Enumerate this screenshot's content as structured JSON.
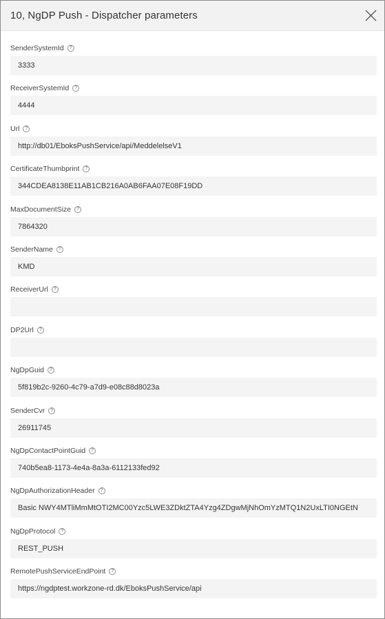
{
  "dialog": {
    "title": "10, NgDP Push - Dispatcher parameters",
    "close_icon": "close-icon"
  },
  "fields": [
    {
      "label": "SenderSystemId",
      "value": "3333"
    },
    {
      "label": "ReceiverSystemId",
      "value": "4444"
    },
    {
      "label": "Url",
      "value": "http://db01/EboksPushService/api/MeddelelseV1"
    },
    {
      "label": "CertificateThumbprint",
      "value": "344CDEA8138E11AB1CB216A0AB6FAA07E08F19DD"
    },
    {
      "label": "MaxDocumentSize",
      "value": "7864320"
    },
    {
      "label": "SenderName",
      "value": "KMD"
    },
    {
      "label": "ReceiverUrl",
      "value": ""
    },
    {
      "label": "DP2Url",
      "value": ""
    },
    {
      "label": "NgDpGuid",
      "value": "5f819b2c-9260-4c79-a7d9-e08c88d8023a"
    },
    {
      "label": "SenderCvr",
      "value": "26911745"
    },
    {
      "label": "NgDpContactPointGuid",
      "value": "740b5ea8-1173-4e4a-8a3a-6112133fed92"
    },
    {
      "label": "NgDpAuthorizationHeader",
      "value": "Basic NWY4MTliMmMtOTI2MC00Yzc5LWE3ZDktZTA4Yzg4ZDgwMjNhOmYzMTQ1N2UxLTI0NGEtN"
    },
    {
      "label": "NgDpProtocol",
      "value": "REST_PUSH"
    },
    {
      "label": "RemotePushServiceEndPoint",
      "value": "https://ngdptest.workzone-rd.dk/EboksPushService/api"
    }
  ],
  "help_icon_glyph": "?"
}
